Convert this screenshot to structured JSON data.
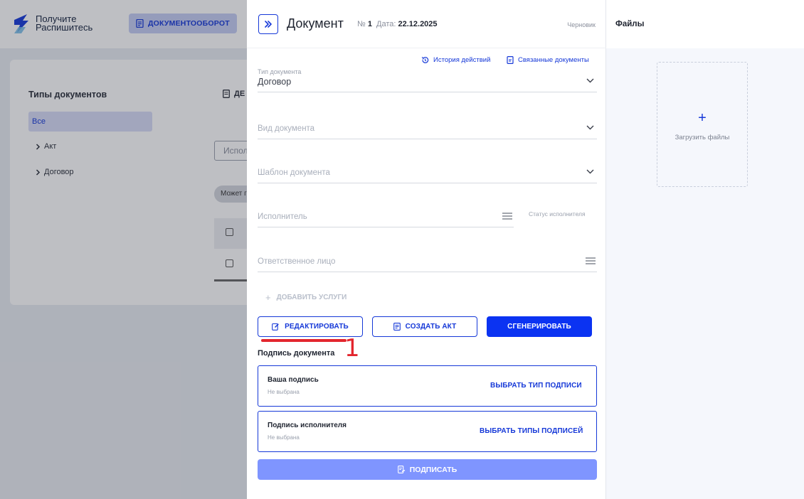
{
  "app": {
    "logo_line1": "Получите",
    "logo_line2": "Распишитесь",
    "nav_button": "ДОКУМЕНТООБОРОТ"
  },
  "background": {
    "types_title": "Типы документов",
    "types": [
      {
        "label": "Все",
        "selected": true
      },
      {
        "label": "Акт"
      },
      {
        "label": "Договор"
      }
    ],
    "action_label": "ДЕ",
    "search_placeholder": "Испол",
    "chip_label": "Может г"
  },
  "document": {
    "title": "Документ",
    "number_prefix": "№",
    "number": "1",
    "date_label": "Дата:",
    "date": "22.12.2025",
    "status": "Черновик",
    "links": {
      "history": "История действий",
      "related": "Связанные документы"
    },
    "fields": {
      "doc_type": {
        "label": "Тип документа",
        "value": "Договор"
      },
      "doc_kind": {
        "placeholder": "Вид документа"
      },
      "doc_template": {
        "placeholder": "Шаблон документа"
      },
      "executor": {
        "placeholder": "Исполнитель"
      },
      "executor_status": "Статус исполнителя",
      "responsible": {
        "placeholder": "Ответственное лицо"
      }
    },
    "add_services": "ДОБАВИТЬ УСЛУГИ",
    "buttons": {
      "edit": "РЕДАКТИРОВАТЬ",
      "create_act": "СОЗДАТЬ АКТ",
      "generate": "СГЕНЕРИРОВАТЬ"
    },
    "annotation_number": "1",
    "signature": {
      "title": "Подпись документа",
      "yours": {
        "name": "Ваша подпись",
        "status": "Не выбрана",
        "action": "ВЫБРАТЬ ТИП ПОДПИСИ"
      },
      "executor": {
        "name": "Подпись исполнителя",
        "status": "Не выбрана",
        "action": "ВЫБРАТЬ ТИПЫ ПОДПИСЕЙ"
      },
      "sign_button": "ПОДПИСАТЬ"
    }
  },
  "files": {
    "title": "Файлы",
    "upload_label": "Загрузить файлы"
  },
  "colors": {
    "accent": "#1538d8",
    "primary_button": "#0b33f2",
    "disabled_button": "#7f95ff",
    "annotation": "#e3262e"
  }
}
